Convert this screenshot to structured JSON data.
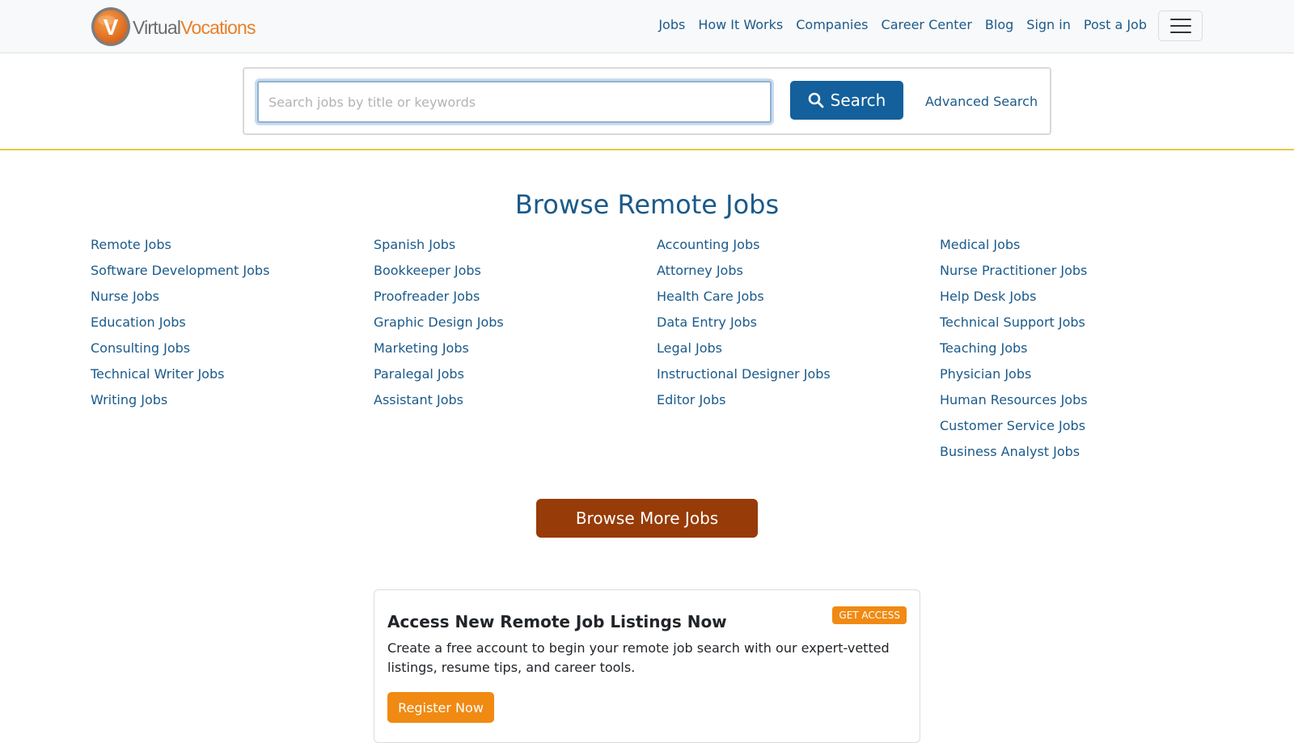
{
  "brand": {
    "logo_letter": "V",
    "name_part1": "Virtual",
    "name_part2": "Vocations",
    "accent_orange": "#e8802a",
    "link_blue": "#1b5a8a"
  },
  "nav": {
    "items": [
      {
        "label": "Jobs"
      },
      {
        "label": "How It Works"
      },
      {
        "label": "Companies"
      },
      {
        "label": "Career Center"
      },
      {
        "label": "Blog"
      },
      {
        "label": "Sign in"
      },
      {
        "label": "Post a Job"
      }
    ],
    "menu_icon": "hamburger-icon"
  },
  "search": {
    "placeholder": "Search jobs by title or keywords",
    "value": "",
    "button_label": "Search",
    "button_icon": "search-icon",
    "advanced_label": "Advanced Search"
  },
  "browse": {
    "title": "Browse Remote Jobs",
    "columns": [
      [
        "Remote Jobs",
        "Software Development Jobs",
        "Nurse Jobs",
        "Education Jobs",
        "Consulting Jobs",
        "Technical Writer Jobs",
        "Writing Jobs"
      ],
      [
        "Spanish Jobs",
        "Bookkeeper Jobs",
        "Proofreader Jobs",
        "Graphic Design Jobs",
        "Marketing Jobs",
        "Paralegal Jobs",
        "Assistant Jobs"
      ],
      [
        "Accounting Jobs",
        "Attorney Jobs",
        "Health Care Jobs",
        "Data Entry Jobs",
        "Legal Jobs",
        "Instructional Designer Jobs",
        "Editor Jobs"
      ],
      [
        "Medical Jobs",
        "Nurse Practitioner Jobs",
        "Help Desk Jobs",
        "Technical Support Jobs",
        "Teaching Jobs",
        "Physician Jobs",
        "Human Resources Jobs",
        "Customer Service Jobs",
        "Business Analyst Jobs"
      ]
    ],
    "more_button_label": "Browse More Jobs"
  },
  "promo": {
    "title": "Access New Remote Job Listings Now",
    "badge": "GET ACCESS",
    "text": "Create a free account to begin your remote job search with our expert-vetted listings, resume tips, and career tools.",
    "button_label": "Register Now"
  }
}
